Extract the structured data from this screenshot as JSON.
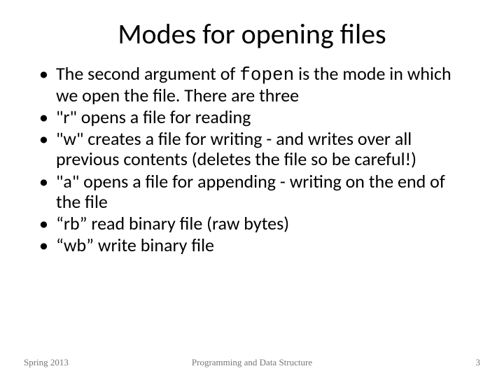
{
  "title": "Modes for opening files",
  "bullets": {
    "b0_pre": "The second argument of ",
    "b0_code": "fopen",
    "b0_post": " is the mode in which we open the file.  There are three",
    "b1": "\"r\" opens a file for reading",
    "b2": "\"w\" creates a file for writing - and writes over all previous contents (deletes the file so be careful!)",
    "b3": "\"a\" opens a file for appending - writing on the end of the file",
    "b4": "“rb” read binary file (raw bytes)",
    "b5": "“wb” write binary file"
  },
  "footer": {
    "left": "Spring 2013",
    "center": "Programming and Data Structure",
    "right": "3"
  }
}
